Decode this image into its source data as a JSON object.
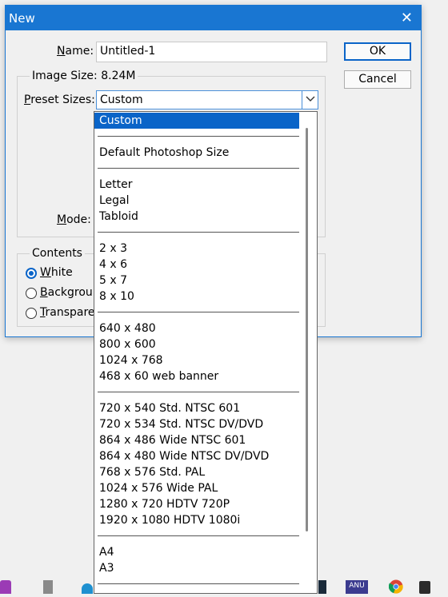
{
  "window": {
    "title": "New",
    "close_glyph": "✕"
  },
  "name_field": {
    "label": "Name:",
    "label_underline": "N",
    "label_rest": "ame:",
    "value": "Untitled-1"
  },
  "buttons": {
    "ok": "OK",
    "cancel": "Cancel"
  },
  "image_size": {
    "label": "Image Size:",
    "value": "8.24M"
  },
  "preset_sizes": {
    "label_underline": "P",
    "label_rest": "reset Sizes:",
    "selected": "Custom"
  },
  "mode": {
    "label_underline": "M",
    "label_rest": "ode:"
  },
  "contents": {
    "legend": "Contents",
    "options": [
      {
        "underline": "W",
        "rest": "hite",
        "checked": true
      },
      {
        "underline": "B",
        "rest": "ackgroun",
        "checked": false
      },
      {
        "underline": "T",
        "rest": "ranspare",
        "checked": false
      }
    ]
  },
  "dropdown_items": [
    "Custom",
    "Default Photoshop Size",
    "Letter",
    "Legal",
    "Tabloid",
    "2 x 3",
    "4 x 6",
    "5 x 7",
    "8 x 10",
    "640 x 480",
    "800 x 600",
    "1024 x 768",
    "468 x 60 web banner",
    "720 x 540 Std. NTSC 601",
    "720 x 534 Std. NTSC DV/DVD",
    "864 x 486 Wide NTSC 601",
    "864 x 480 Wide NTSC DV/DVD",
    "768 x 576 Std. PAL",
    "1024 x 576 Wide PAL",
    "1280 x 720 HDTV 720P",
    "1920 x 1080 HDTV 1080i",
    "A4",
    "A3"
  ],
  "taskbar": {
    "anu_label": "ANU"
  },
  "colors": {
    "accent": "#1976d2",
    "selection": "#0a64c8"
  }
}
